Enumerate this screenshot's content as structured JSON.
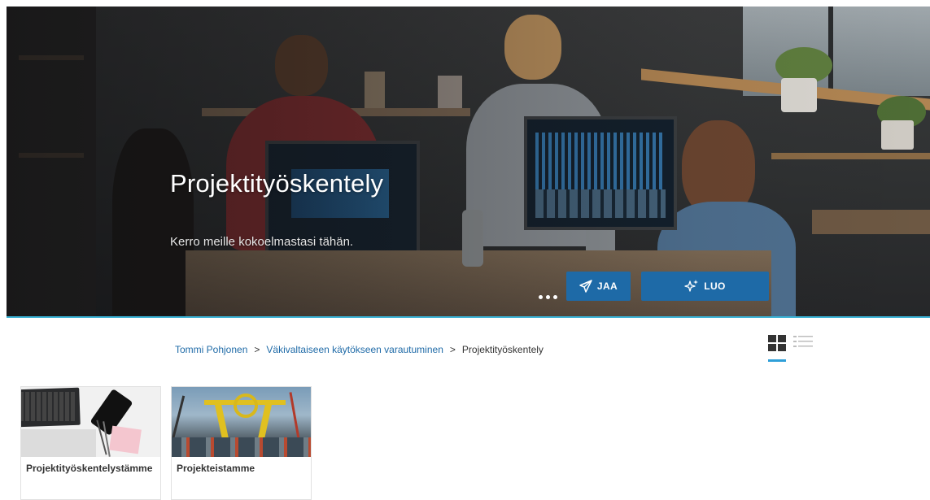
{
  "hero": {
    "title": "Projektityöskentely",
    "subtitle": "Kerro meille kokoelmastasi tähän.",
    "more_icon": "more-dots-icon",
    "share_label": "JAA",
    "share_icon": "paper-plane-icon",
    "create_label": "LUO",
    "create_icon": "sparkle-icon",
    "button_color": "#1e6aa7"
  },
  "breadcrumb": {
    "items": [
      "Tommi Pohjonen",
      "Väkivaltaiseen käytökseen varautuminen"
    ],
    "current": "Projektityöskentely",
    "separator": ">"
  },
  "view_toggle": {
    "active": "grid",
    "grid_icon": "grid-view-icon",
    "list_icon": "list-view-icon",
    "accent": "#2f9fd8"
  },
  "cards": [
    {
      "title": "Projektityöskentelystämme",
      "thumb": "laptop-desk-photo"
    },
    {
      "title": "Projekteistamme",
      "thumb": "construction-site-photo"
    }
  ]
}
